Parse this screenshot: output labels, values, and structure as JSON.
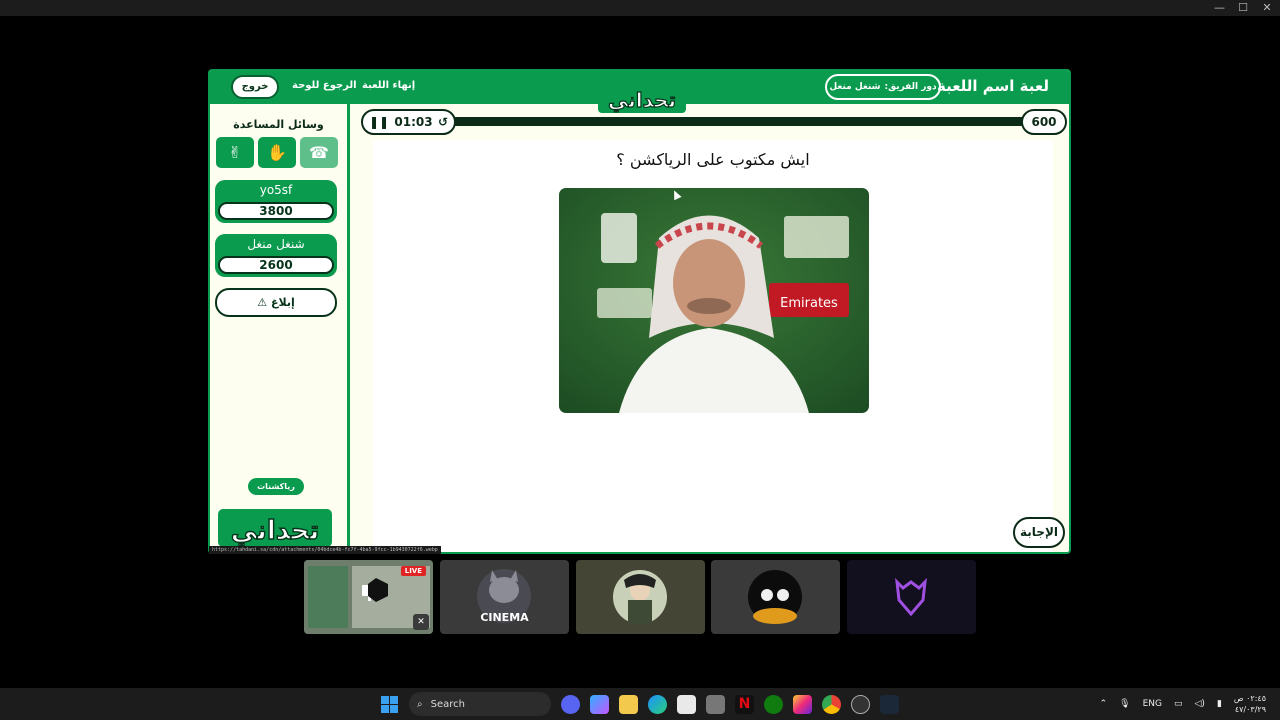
{
  "window": {
    "controls": [
      "—",
      "☐",
      "✕"
    ]
  },
  "header": {
    "exit_label": "خروج",
    "back_label": "الرجوع للوحة",
    "end_label": "إنهاء اللعبة",
    "turn_label": "دور الفريق:",
    "turn_team": "شنغل منغل",
    "game_title": "لعبة اسم اللعبة",
    "logo_text": "تحداني"
  },
  "sidebar": {
    "help_title": "وسائل المساعدة",
    "teams": [
      {
        "name": "yo5sf",
        "score": "3800"
      },
      {
        "name": "شنغل منغل",
        "score": "2600"
      }
    ],
    "report_label": "إبلاغ",
    "reactions_label": "رياكشنات",
    "logo_text": "تحداني"
  },
  "game": {
    "timer": "01:03",
    "points": "600",
    "timer_progress": 0.0,
    "question": "ايش مكتوب على الرياكشن ؟",
    "answer_label": "الإجابة"
  },
  "status": {
    "url": "https://tahdani.sa/cdn/attachments/04bdce4b-fc7f-4ba5-9fcc-1b9430722f6.webp"
  },
  "participants": {
    "live_label": "LIVE",
    "tile2_caption": "CINEMA"
  },
  "taskbar": {
    "search_placeholder": "Search",
    "lang": "ENG",
    "time": "٠٢:٤٥ ص",
    "date": "٤٧/٠٣/٢٩"
  },
  "colors": {
    "brand_green": "#0a9b4f",
    "dark": "#0b2a17",
    "cream": "#fdfdf0"
  }
}
